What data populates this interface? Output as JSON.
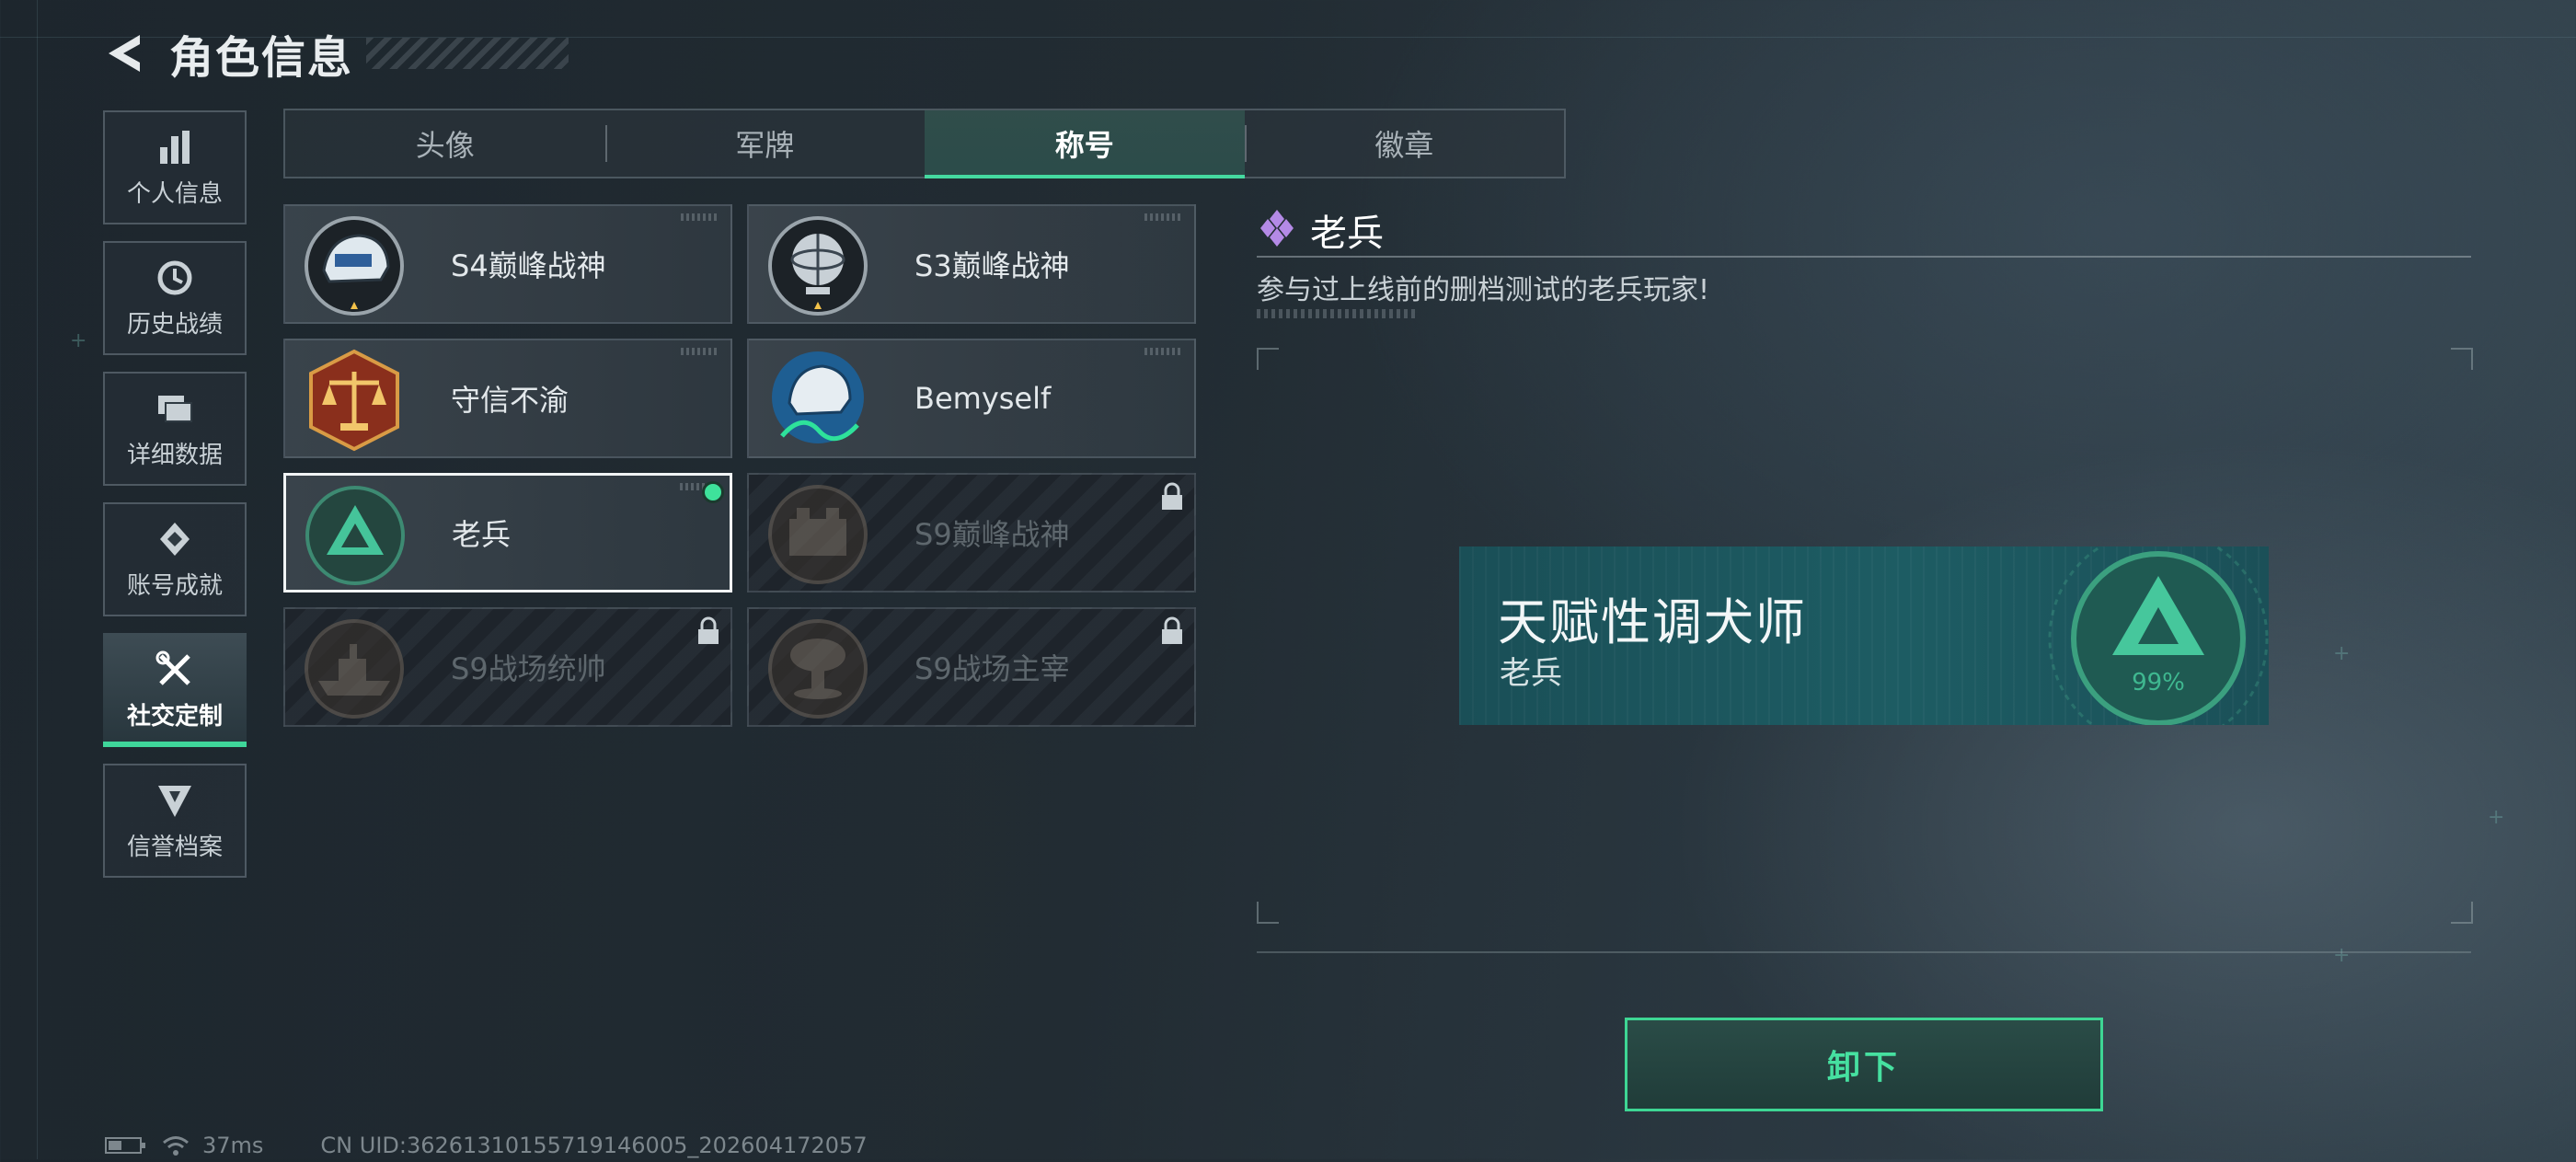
{
  "header": {
    "title": "角色信息"
  },
  "sidebar": {
    "items": [
      {
        "label": "个人信息",
        "icon": "bar-chart-icon"
      },
      {
        "label": "历史战绩",
        "icon": "clock-icon"
      },
      {
        "label": "详细数据",
        "icon": "folder-icon"
      },
      {
        "label": "账号成就",
        "icon": "achievement-icon"
      },
      {
        "label": "社交定制",
        "icon": "tools-icon",
        "active": true
      },
      {
        "label": "信誉档案",
        "icon": "credit-shield-icon"
      }
    ]
  },
  "tabs": [
    {
      "label": "头像"
    },
    {
      "label": "军牌"
    },
    {
      "label": "称号",
      "active": true
    },
    {
      "label": "徽章"
    }
  ],
  "titles": [
    {
      "name": "S4巅峰战神",
      "locked": false,
      "icon": "helmet-emblem-icon"
    },
    {
      "name": "S3巅峰战神",
      "locked": false,
      "icon": "globe-emblem-icon"
    },
    {
      "name": "守信不渝",
      "locked": false,
      "icon": "scales-emblem-icon"
    },
    {
      "name": "Bemyself",
      "locked": false,
      "icon": "signature-helmet-emblem-icon"
    },
    {
      "name": "老兵",
      "locked": false,
      "selected": true,
      "equipped": true,
      "icon": "veteran-triangle-emblem-icon",
      "percent": "99%"
    },
    {
      "name": "S9巅峰战神",
      "locked": true,
      "icon": "fortress-emblem-icon"
    },
    {
      "name": "S9战场统帅",
      "locked": true,
      "icon": "warship-emblem-icon"
    },
    {
      "name": "S9战场主宰",
      "locked": true,
      "icon": "mushroom-cloud-emblem-icon"
    }
  ],
  "detail": {
    "title": "老兵",
    "description": "参与过上线前的删档测试的老兵玩家!"
  },
  "preview": {
    "main_text": "天赋性调犬师",
    "sub_text": "老兵",
    "emblem_percent": "99%"
  },
  "actions": {
    "unequip_label": "卸下"
  },
  "status": {
    "ping": "37ms",
    "uid": "CN UID:36261310155719146005_202604172057"
  },
  "colors": {
    "accent": "#3fd69a",
    "banner": "#1d5c63",
    "background": "#222c33"
  }
}
